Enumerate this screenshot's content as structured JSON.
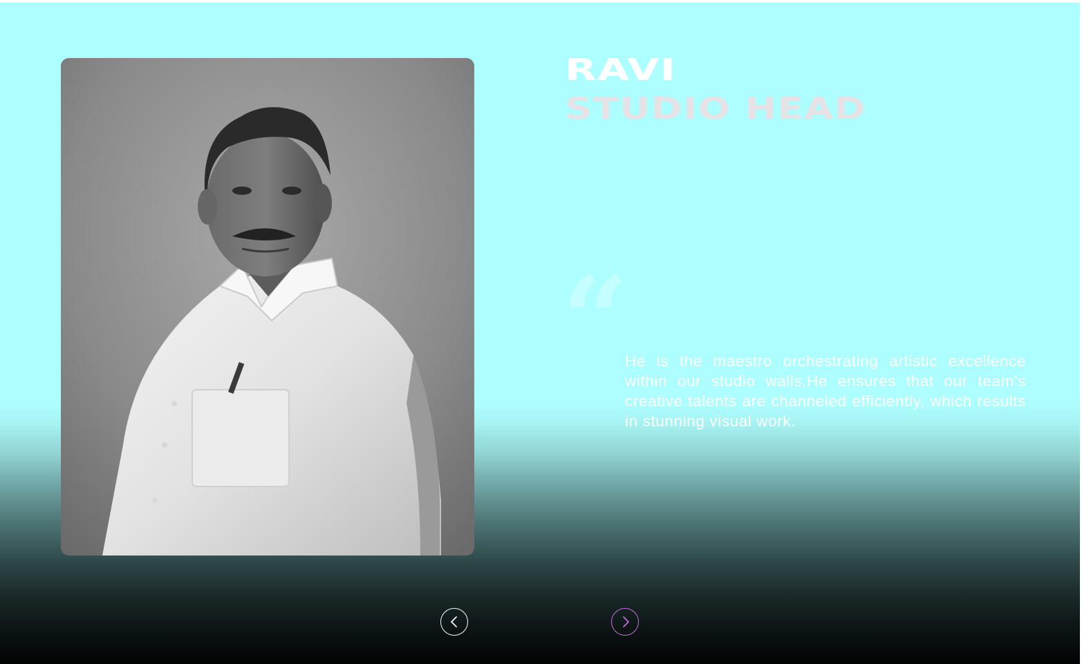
{
  "profile": {
    "name": "RAVI",
    "role": "STUDIO HEAD",
    "bio": "He is the maestro orchestrating artistic excellence within our studio walls.He ensures that our team’s creative talents are channeled efficiently, which results in stunning visual work."
  },
  "quote_glyph": "“",
  "navigation": {
    "prev_icon": "chevron-left-icon",
    "next_icon": "chevron-right-icon"
  },
  "colors": {
    "background_top": "#adfefe",
    "background_bottom": "#020404",
    "name_color": "#ffffff",
    "role_color": "#e6e2e6",
    "next_button_accent": "#c86fe0"
  }
}
